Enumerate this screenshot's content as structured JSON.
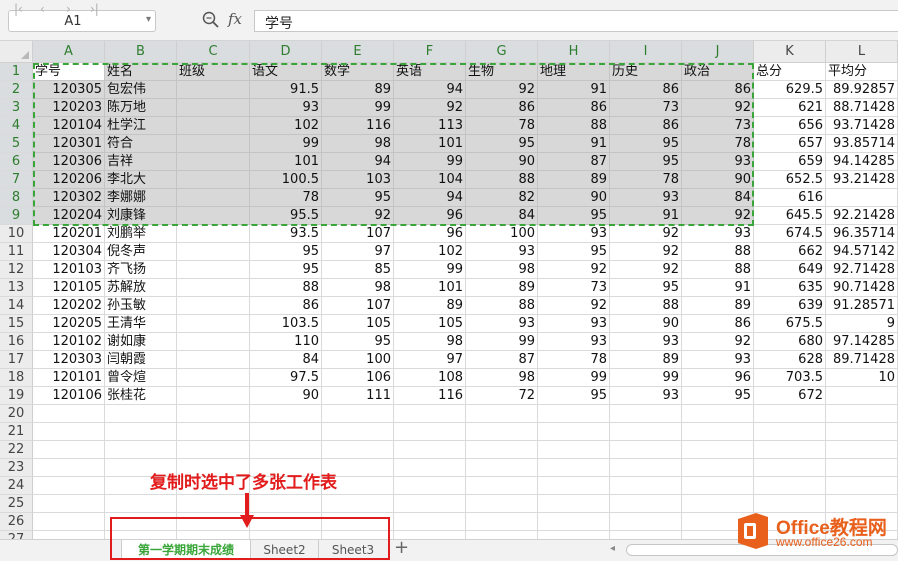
{
  "formula_bar": {
    "name_box": "A1",
    "fx_label": "fx",
    "content": "学号"
  },
  "columns": [
    "A",
    "B",
    "C",
    "D",
    "E",
    "F",
    "G",
    "H",
    "I",
    "J",
    "K",
    "L"
  ],
  "headers": [
    "学号",
    "姓名",
    "班级",
    "语文",
    "数学",
    "英语",
    "生物",
    "地理",
    "历史",
    "政治",
    "总分",
    "平均分"
  ],
  "rows": [
    [
      "120305",
      "包宏伟",
      "",
      "91.5",
      "89",
      "94",
      "92",
      "91",
      "86",
      "86",
      "629.5",
      "89.92857"
    ],
    [
      "120203",
      "陈万地",
      "",
      "93",
      "99",
      "92",
      "86",
      "86",
      "73",
      "92",
      "621",
      "88.71428"
    ],
    [
      "120104",
      "杜学江",
      "",
      "102",
      "116",
      "113",
      "78",
      "88",
      "86",
      "73",
      "656",
      "93.71428"
    ],
    [
      "120301",
      "符合",
      "",
      "99",
      "98",
      "101",
      "95",
      "91",
      "95",
      "78",
      "657",
      "93.85714"
    ],
    [
      "120306",
      "吉祥",
      "",
      "101",
      "94",
      "99",
      "90",
      "87",
      "95",
      "93",
      "659",
      "94.14285"
    ],
    [
      "120206",
      "李北大",
      "",
      "100.5",
      "103",
      "104",
      "88",
      "89",
      "78",
      "90",
      "652.5",
      "93.21428"
    ],
    [
      "120302",
      "李娜娜",
      "",
      "78",
      "95",
      "94",
      "82",
      "90",
      "93",
      "84",
      "616",
      ""
    ],
    [
      "120204",
      "刘康锋",
      "",
      "95.5",
      "92",
      "96",
      "84",
      "95",
      "91",
      "92",
      "645.5",
      "92.21428"
    ],
    [
      "120201",
      "刘鹏举",
      "",
      "93.5",
      "107",
      "96",
      "100",
      "93",
      "92",
      "93",
      "674.5",
      "96.35714"
    ],
    [
      "120304",
      "倪冬声",
      "",
      "95",
      "97",
      "102",
      "93",
      "95",
      "92",
      "88",
      "662",
      "94.57142"
    ],
    [
      "120103",
      "齐飞扬",
      "",
      "95",
      "85",
      "99",
      "98",
      "92",
      "92",
      "88",
      "649",
      "92.71428"
    ],
    [
      "120105",
      "苏解放",
      "",
      "88",
      "98",
      "101",
      "89",
      "73",
      "95",
      "91",
      "635",
      "90.71428"
    ],
    [
      "120202",
      "孙玉敏",
      "",
      "86",
      "107",
      "89",
      "88",
      "92",
      "88",
      "89",
      "639",
      "91.28571"
    ],
    [
      "120205",
      "王清华",
      "",
      "103.5",
      "105",
      "105",
      "93",
      "93",
      "90",
      "86",
      "675.5",
      "9"
    ],
    [
      "120102",
      "谢如康",
      "",
      "110",
      "95",
      "98",
      "99",
      "93",
      "93",
      "92",
      "680",
      "97.14285"
    ],
    [
      "120303",
      "闫朝霞",
      "",
      "84",
      "100",
      "97",
      "87",
      "78",
      "89",
      "93",
      "628",
      "89.71428"
    ],
    [
      "120101",
      "曾令煊",
      "",
      "97.5",
      "106",
      "108",
      "98",
      "99",
      "99",
      "96",
      "703.5",
      "10"
    ],
    [
      "120106",
      "张桂花",
      "",
      "90",
      "111",
      "116",
      "72",
      "95",
      "93",
      "95",
      "672",
      ""
    ]
  ],
  "row_numbers": [
    "1",
    "2",
    "3",
    "4",
    "5",
    "6",
    "7",
    "8",
    "9",
    "10",
    "11",
    "12",
    "13",
    "14",
    "15",
    "16",
    "17",
    "18",
    "19",
    "20",
    "21",
    "22",
    "23",
    "24",
    "25",
    "26",
    "27"
  ],
  "annotation": "复制时选中了多张工作表",
  "sheet_tabs": [
    "第一学期期末成绩",
    "Sheet2",
    "Sheet3"
  ],
  "logo": {
    "line1": "Office教程网",
    "line2": "www.office26.com"
  },
  "colors": {
    "selection_dash": "#3aa63a",
    "annotation_red": "#e21c1c",
    "logo_orange": "#e8601c"
  }
}
